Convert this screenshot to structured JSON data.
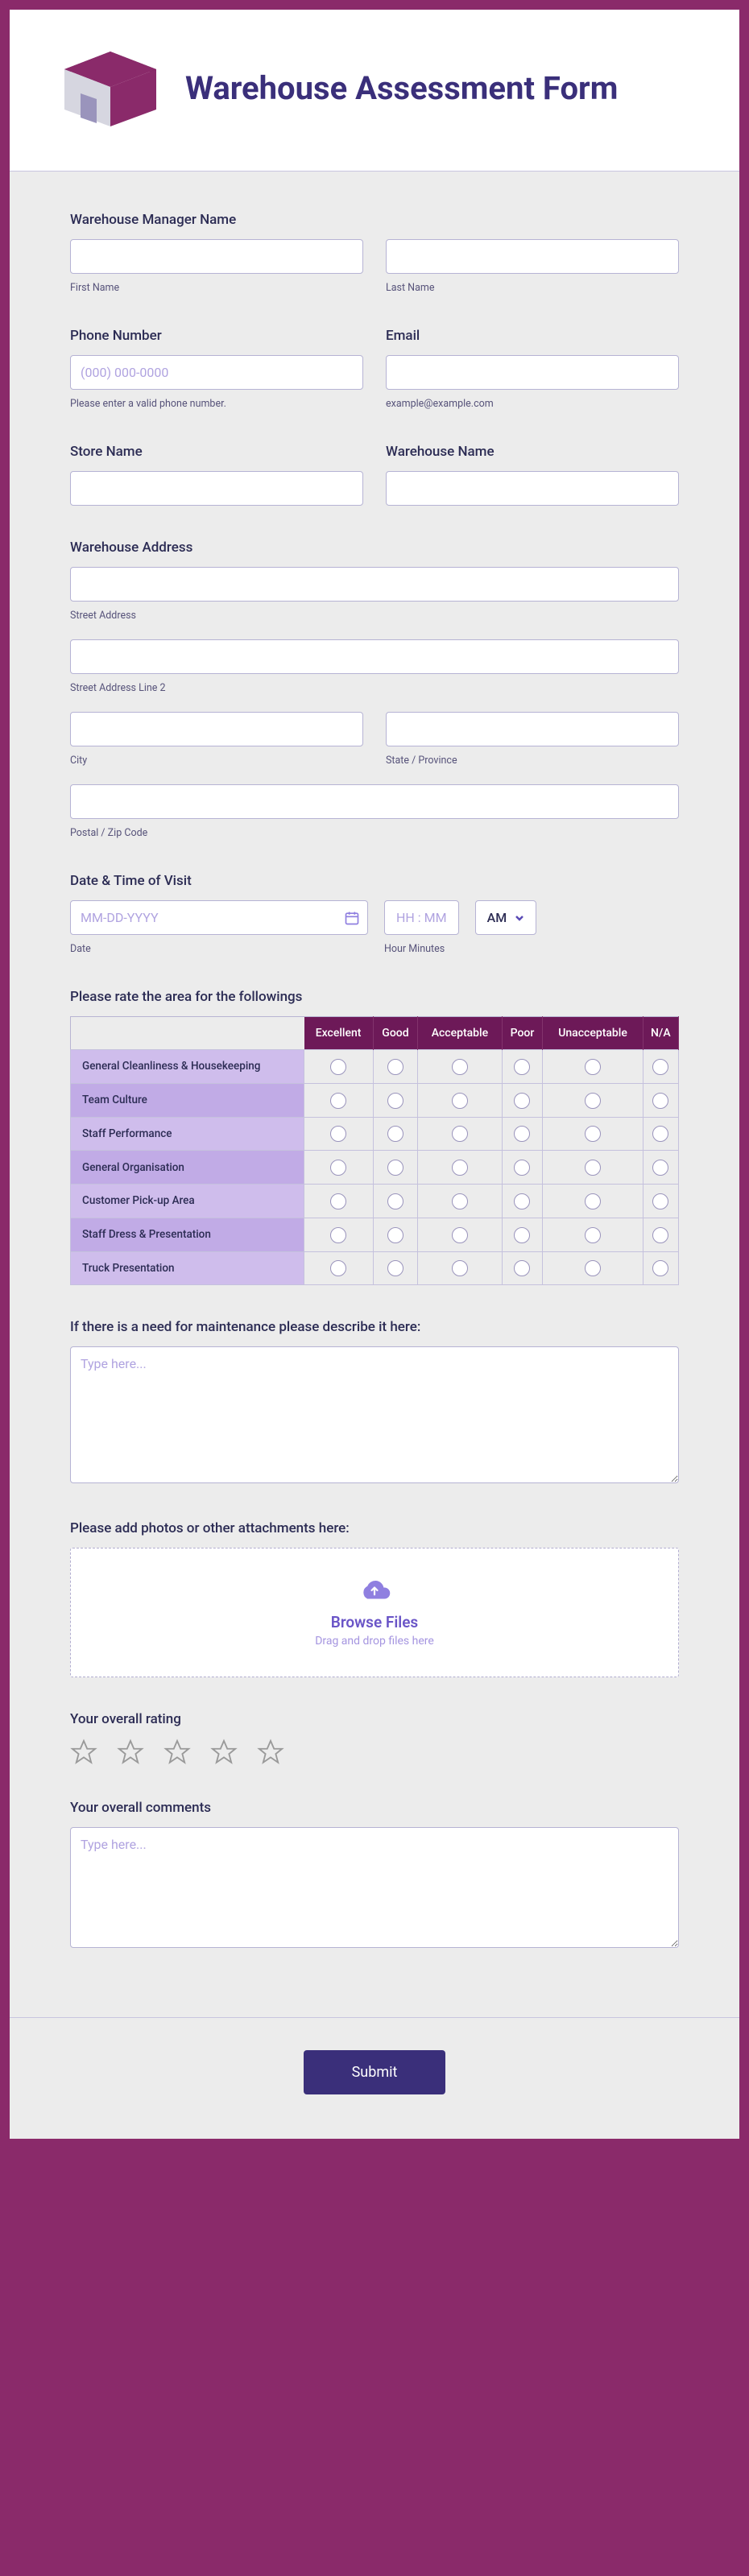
{
  "header": {
    "title": "Warehouse Assessment Form"
  },
  "manager": {
    "label": "Warehouse Manager Name",
    "first_sub": "First Name",
    "last_sub": "Last Name"
  },
  "phone": {
    "label": "Phone Number",
    "placeholder": "(000) 000-0000",
    "sub": "Please enter a valid phone number."
  },
  "email": {
    "label": "Email",
    "sub": "example@example.com"
  },
  "store": {
    "label": "Store Name"
  },
  "warehouse": {
    "label": "Warehouse Name"
  },
  "address": {
    "label": "Warehouse Address",
    "street": "Street Address",
    "street2": "Street Address Line 2",
    "city": "City",
    "state": "State / Province",
    "postal": "Postal / Zip Code"
  },
  "visit": {
    "label": "Date & Time of Visit",
    "date_placeholder": "MM-DD-YYYY",
    "date_sub": "Date",
    "time_placeholder": "HH : MM",
    "time_sub": "Hour Minutes",
    "ampm": "AM"
  },
  "rating": {
    "label": "Please rate the area for the followings",
    "columns": [
      "Excellent",
      "Good",
      "Acceptable",
      "Poor",
      "Unacceptable",
      "N/A"
    ],
    "rows": [
      "General Cleanliness & Housekeeping",
      "Team Culture",
      "Staff Performance",
      "General Organisation",
      "Customer Pick-up Area",
      "Staff Dress & Presentation",
      "Truck Presentation"
    ]
  },
  "maintenance": {
    "label": "If there is a need for maintenance please describe it here:",
    "placeholder": "Type here..."
  },
  "attachments": {
    "label": "Please add photos or other attachments here:",
    "browse": "Browse Files",
    "dd": "Drag and drop files here"
  },
  "overall_rating": {
    "label": "Your overall rating"
  },
  "comments": {
    "label": "Your overall comments",
    "placeholder": "Type here..."
  },
  "footer": {
    "submit": "Submit"
  }
}
